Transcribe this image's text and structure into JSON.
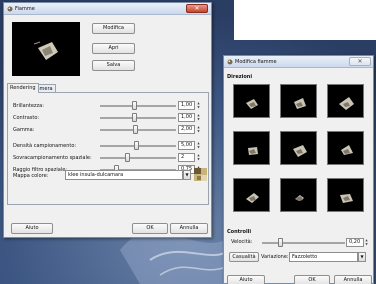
{
  "colors": {
    "bg": "#3a5580",
    "win": "#f0f0f0",
    "title_bar": "#d9e4f2",
    "close_red": "#c8432b"
  },
  "flame_window": {
    "title": "Fiamme",
    "buttons": {
      "edit": "Modifica",
      "open": "Apri",
      "save": "Salva"
    },
    "tabs": [
      {
        "label": "Rendering",
        "active": true
      },
      {
        "label": "Camera",
        "active": false
      }
    ],
    "rows": [
      {
        "label": "Brillantezza:",
        "value": "1,00",
        "level": 0.45
      },
      {
        "label": "Contrasto:",
        "value": "1,00",
        "level": 0.45
      },
      {
        "label": "Gamma:",
        "value": "2,00",
        "level": 0.47
      },
      {
        "label": "Densità campionamento:",
        "value": "5,00",
        "level": 0.49
      },
      {
        "label": "Sovracampionamento spaziale:",
        "value": "2",
        "level": 0.35
      },
      {
        "label": "Raggio filtro spaziale:",
        "value": "0,75",
        "level": 0.2
      }
    ],
    "colormap": {
      "label": "Mappa colore:",
      "value": "klee insula-dulcamara"
    },
    "footer": {
      "help": "Aiuto",
      "ok": "OK",
      "cancel": "Annulla"
    }
  },
  "edit_window": {
    "title": "Modifica fiamme",
    "directions_title": "Direzioni",
    "grid_count": 9,
    "controls_title": "Controlli",
    "speed": {
      "label": "Velocità:",
      "value": "0,20",
      "level": 0.2
    },
    "random": {
      "label": "Casualità"
    },
    "variation": {
      "label": "Variazione:",
      "value": "Fazzoletto"
    },
    "footer": {
      "help": "Aiuto",
      "ok": "OK",
      "cancel": "Annulla"
    }
  }
}
